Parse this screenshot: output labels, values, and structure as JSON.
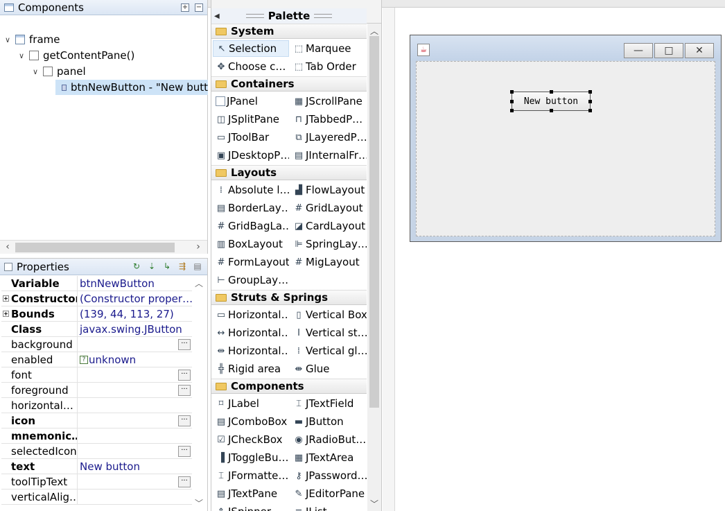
{
  "components_view": {
    "title": "Components",
    "tree": [
      {
        "label": "frame",
        "twisty": "∨",
        "icon": "frame"
      },
      {
        "label": "getContentPane()",
        "twisty": "∨",
        "icon": "pane"
      },
      {
        "label": "panel",
        "twisty": "∨",
        "icon": "pane"
      },
      {
        "label": "btnNewButton - \"New butt",
        "twisty": "",
        "icon": "btn"
      }
    ]
  },
  "properties_view": {
    "title": "Properties",
    "rows": [
      {
        "name": "Variable",
        "value": "btnNewButton",
        "bold": true
      },
      {
        "name": "Constructor",
        "value": "(Constructor proper…",
        "bold": true,
        "expand": true
      },
      {
        "name": "Bounds",
        "value": "(139, 44, 113, 27)",
        "bold": true,
        "expand": true
      },
      {
        "name": "Class",
        "value": "javax.swing.JButton",
        "bold": true
      },
      {
        "name": "background",
        "value": "",
        "dots": true
      },
      {
        "name": "enabled",
        "value": "unknown",
        "qmark": true
      },
      {
        "name": "font",
        "value": "",
        "dots": true
      },
      {
        "name": "foreground",
        "value": "",
        "dots": true
      },
      {
        "name": "horizontal…",
        "value": ""
      },
      {
        "name": "icon",
        "value": "",
        "bold": true,
        "dots": true
      },
      {
        "name": "mnemonic…",
        "value": "",
        "bold": true
      },
      {
        "name": "selectedIcon",
        "value": "",
        "dots": true
      },
      {
        "name": "text",
        "value": "New button",
        "bold": true
      },
      {
        "name": "toolTipText",
        "value": "",
        "dots": true
      },
      {
        "name": "verticalAlig…",
        "value": ""
      }
    ]
  },
  "palette": {
    "title": "Palette",
    "categories": [
      {
        "name": "System",
        "items": [
          {
            "label": "Selection",
            "icon": "cursor-icon",
            "glyph": "↖",
            "selected": true
          },
          {
            "label": "Marquee",
            "icon": "marquee-icon",
            "glyph": "⬚"
          },
          {
            "label": "Choose c…",
            "icon": "choose-component-icon",
            "glyph": "✥"
          },
          {
            "label": "Tab Order",
            "icon": "tab-order-icon",
            "glyph": "⬚"
          }
        ]
      },
      {
        "name": "Containers",
        "items": [
          {
            "label": "JPanel",
            "icon": "jpanel-icon",
            "glyph": ""
          },
          {
            "label": "JScrollPane",
            "icon": "jscrollpane-icon",
            "glyph": "▦"
          },
          {
            "label": "JSplitPane",
            "icon": "jsplitpane-icon",
            "glyph": "◫"
          },
          {
            "label": "JTabbedP…",
            "icon": "jtabbedpane-icon",
            "glyph": "⊓"
          },
          {
            "label": "JToolBar",
            "icon": "jtoolbar-icon",
            "glyph": "▭"
          },
          {
            "label": "JLayeredP…",
            "icon": "jlayeredpane-icon",
            "glyph": "⧉"
          },
          {
            "label": "JDesktopP…",
            "icon": "jdesktoppane-icon",
            "glyph": "▣"
          },
          {
            "label": "JInternalFr…",
            "icon": "jinternalframe-icon",
            "glyph": "▤"
          }
        ]
      },
      {
        "name": "Layouts",
        "items": [
          {
            "label": "Absolute l…",
            "icon": "absolute-layout-icon",
            "glyph": "⁞"
          },
          {
            "label": "FlowLayout",
            "icon": "flowlayout-icon",
            "glyph": "▟"
          },
          {
            "label": "BorderLay…",
            "icon": "borderlayout-icon",
            "glyph": "▤"
          },
          {
            "label": "GridLayout",
            "icon": "gridlayout-icon",
            "glyph": "#"
          },
          {
            "label": "GridBagLa…",
            "icon": "gridbaglayout-icon",
            "glyph": "#"
          },
          {
            "label": "CardLayout",
            "icon": "cardlayout-icon",
            "glyph": "◪"
          },
          {
            "label": "BoxLayout",
            "icon": "boxlayout-icon",
            "glyph": "▥"
          },
          {
            "label": "SpringLay…",
            "icon": "springlayout-icon",
            "glyph": "⊫"
          },
          {
            "label": "FormLayout",
            "icon": "formlayout-icon",
            "glyph": "#"
          },
          {
            "label": "MigLayout",
            "icon": "miglayout-icon",
            "glyph": "#"
          },
          {
            "label": "GroupLay…",
            "icon": "grouplayout-icon",
            "glyph": "⊢"
          }
        ]
      },
      {
        "name": "Struts & Springs",
        "items": [
          {
            "label": "Horizontal…",
            "icon": "horizontal-box-icon",
            "glyph": "▭"
          },
          {
            "label": "Vertical Box",
            "icon": "vertical-box-icon",
            "glyph": "▯"
          },
          {
            "label": "Horizontal…",
            "icon": "horizontal-strut-icon",
            "glyph": "↔"
          },
          {
            "label": "Vertical st…",
            "icon": "vertical-strut-icon",
            "glyph": "I"
          },
          {
            "label": "Horizontal…",
            "icon": "horizontal-glue-icon",
            "glyph": "⇹"
          },
          {
            "label": "Vertical gl…",
            "icon": "vertical-glue-icon",
            "glyph": "⁞"
          },
          {
            "label": "Rigid area",
            "icon": "rigid-area-icon",
            "glyph": "╬"
          },
          {
            "label": "Glue",
            "icon": "glue-icon",
            "glyph": "⇼"
          }
        ]
      },
      {
        "name": "Components",
        "items": [
          {
            "label": "JLabel",
            "icon": "jlabel-icon",
            "glyph": "⌑"
          },
          {
            "label": "JTextField",
            "icon": "jtextfield-icon",
            "glyph": "⌶"
          },
          {
            "label": "JComboBox",
            "icon": "jcombobox-icon",
            "glyph": "▤"
          },
          {
            "label": "JButton",
            "icon": "jbutton-icon",
            "glyph": "▬"
          },
          {
            "label": "JCheckBox",
            "icon": "jcheckbox-icon",
            "glyph": "☑"
          },
          {
            "label": "JRadioBut…",
            "icon": "jradiobutton-icon",
            "glyph": "◉"
          },
          {
            "label": "JToggleBu…",
            "icon": "jtogglebutton-icon",
            "glyph": "▐"
          },
          {
            "label": "JTextArea",
            "icon": "jtextarea-icon",
            "glyph": "▦"
          },
          {
            "label": "JFormatte…",
            "icon": "jformattedtextfield-icon",
            "glyph": "⌶"
          },
          {
            "label": "JPassword…",
            "icon": "jpasswordfield-icon",
            "glyph": "⚷"
          },
          {
            "label": "JTextPane",
            "icon": "jtextpane-icon",
            "glyph": "▤"
          },
          {
            "label": "JEditorPane",
            "icon": "jeditorpane-icon",
            "glyph": "✎"
          },
          {
            "label": "JSpinner",
            "icon": "jspinner-icon",
            "glyph": "⇕"
          },
          {
            "label": "JList",
            "icon": "jlist-icon",
            "glyph": "≡"
          }
        ]
      }
    ]
  },
  "design": {
    "button_text": "New button",
    "window_buttons": [
      "—",
      "□",
      "✕"
    ],
    "java_icon": "☕"
  }
}
